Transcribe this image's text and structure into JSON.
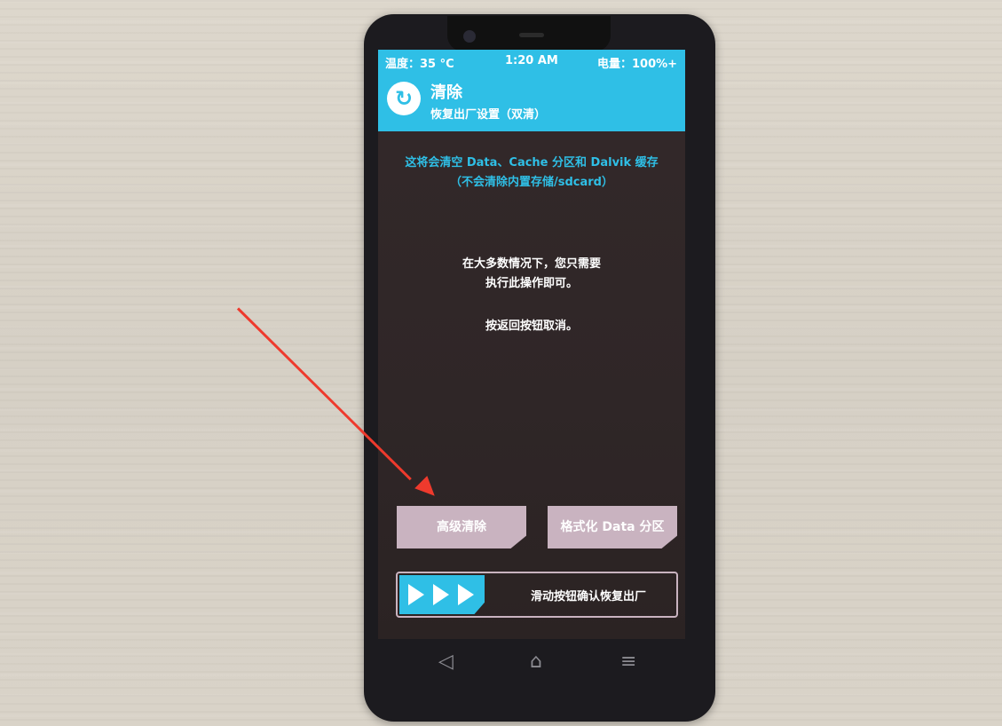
{
  "status_bar": {
    "temperature": "温度：35 °C",
    "time": "1:20 AM",
    "battery": "电量：100%+"
  },
  "header": {
    "title": "清除",
    "subtitle": "恢复出厂设置（双清）"
  },
  "info": {
    "line1": "这将会清空 Data、Cache 分区和 Dalvik 缓存",
    "line2": "（不会清除内置存储/sdcard）",
    "line3": "在大多数情况下，您只需要",
    "line4": "执行此操作即可。",
    "line5": "按返回按钮取消。"
  },
  "buttons": {
    "advanced_wipe": "高级清除",
    "format_data": "格式化 Data 分区"
  },
  "slider": {
    "label": "滑动按钮确认恢复出厂"
  },
  "navbar": {
    "back": "◁",
    "home": "⌂",
    "menu": "≡"
  },
  "colors": {
    "accent": "#2fbfe6",
    "button": "#c9b3c0",
    "arrow": "#ee3a2d"
  }
}
